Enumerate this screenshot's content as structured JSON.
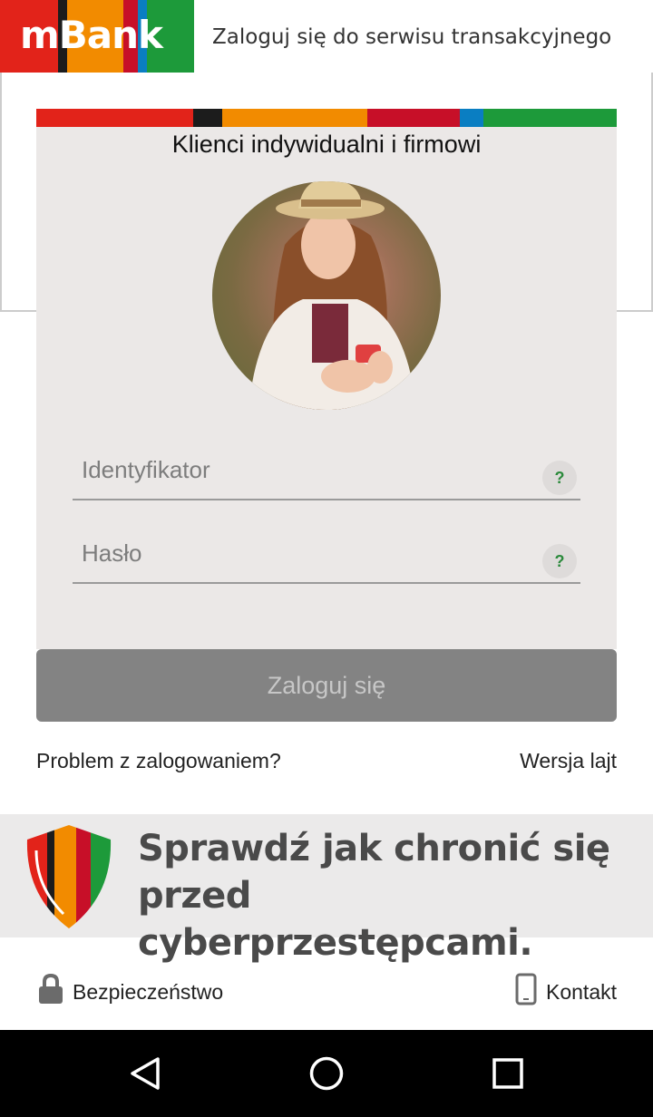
{
  "header": {
    "logo_text": "mBank",
    "title": "Zaloguj się do serwisu transakcyjnego"
  },
  "colors": {
    "red": "#e2231a",
    "black": "#1c1c1c",
    "orange": "#f28b00",
    "crimson": "#c70f28",
    "blue": "#0a7ec2",
    "green": "#1d9a3a",
    "panel_bg": "#ebe8e7",
    "button_bg": "#838383"
  },
  "login": {
    "panel_title": "Klienci indywidualni i firmowi",
    "id_placeholder": "Identyfikator",
    "password_placeholder": "Hasło",
    "help_symbol": "?",
    "submit_label": "Zaloguj się"
  },
  "links": {
    "problem": "Problem z zalogowaniem?",
    "lite": "Wersja lajt"
  },
  "banner": {
    "line1": "Sprawdź jak chronić się",
    "line2": "przed cyberprzestępcami."
  },
  "footer": {
    "security_label": "Bezpieczeństwo",
    "security_icon": "lock-icon",
    "contact_label": "Kontakt",
    "contact_icon": "phone-icon"
  },
  "navbar": {
    "back_icon": "back-triangle-icon",
    "home_icon": "home-circle-icon",
    "recents_icon": "recents-square-icon"
  }
}
